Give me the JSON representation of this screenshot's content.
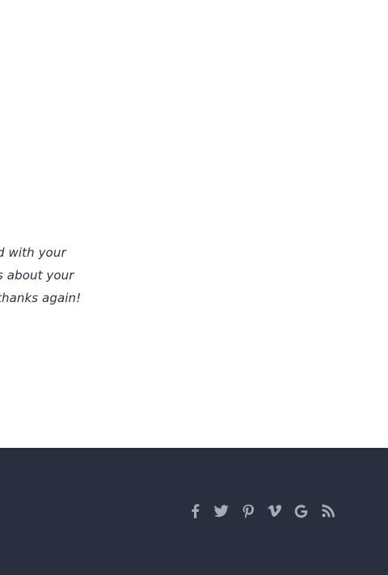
{
  "testimonial": {
    "lines": [
      "d with your",
      "s about your",
      " thanks again!"
    ]
  },
  "footer": {
    "social_icons": [
      {
        "name": "facebook-icon",
        "label": "Facebook"
      },
      {
        "name": "twitter-icon",
        "label": "Twitter"
      },
      {
        "name": "pinterest-icon",
        "label": "Pinterest"
      },
      {
        "name": "vimeo-icon",
        "label": "Vimeo"
      },
      {
        "name": "google-icon",
        "label": "Google"
      },
      {
        "name": "rss-icon",
        "label": "RSS"
      }
    ]
  },
  "colors": {
    "page_background": "#ffffff",
    "footer_background": "#2a2f3f",
    "icon_color": "#a9acb5",
    "text_color": "#2d3140"
  }
}
